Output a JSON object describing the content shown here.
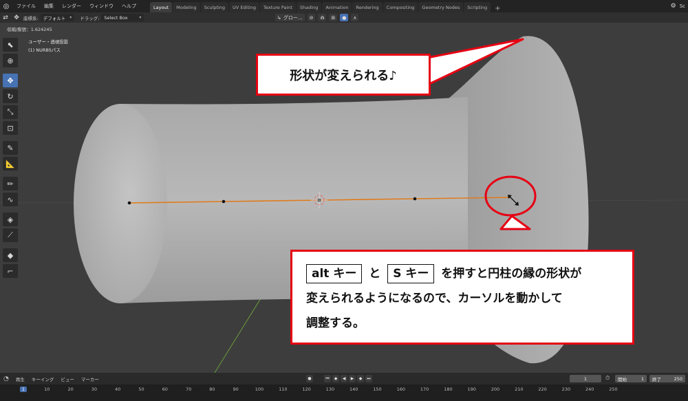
{
  "menubar": {
    "items": [
      "ファイル",
      "編集",
      "レンダー",
      "ウィンドウ",
      "ヘルプ"
    ],
    "workspaces": [
      "Layout",
      "Modeling",
      "Sculpting",
      "UV Editing",
      "Texture Paint",
      "Shading",
      "Animation",
      "Rendering",
      "Compositing",
      "Geometry Nodes",
      "Scripting"
    ],
    "active_workspace": "Layout",
    "scene_label": "Sc"
  },
  "toolhdr": {
    "transform_label": "座標系:",
    "orientation": "デフォルト",
    "drag_label": "ドラッグ:",
    "drag_value": "Select Box",
    "pivot_label": "グロー..."
  },
  "viewport": {
    "readout": "収縮/膨張：1.624245",
    "view_title": "ユーザー・透視投影",
    "object_name": "(1) NURBSパス"
  },
  "callouts": {
    "top_text": "形状が変えられる♪",
    "key1": "alt キー",
    "and": "と",
    "key2": "S キー",
    "line1_rest": "を押すと円柱の縁の形状が",
    "line2": "変えられるようになるので、カーソルを動かして",
    "line3": "調整する。"
  },
  "timeline": {
    "menus": [
      "再生",
      "キーイング",
      "ビュー",
      "マーカー"
    ],
    "current_frame": "1",
    "start_label": "開始",
    "start_value": "1",
    "end_label": "終了",
    "end_value": "250",
    "ticks": [
      "1",
      "10",
      "20",
      "30",
      "40",
      "50",
      "60",
      "70",
      "80",
      "90",
      "100",
      "110",
      "120",
      "130",
      "140",
      "150",
      "160",
      "170",
      "180",
      "190",
      "200",
      "210",
      "220",
      "230",
      "240",
      "250"
    ]
  },
  "colors": {
    "accent": "#4772b3",
    "callout_border": "#e60012",
    "curve": "#e07b1b"
  }
}
